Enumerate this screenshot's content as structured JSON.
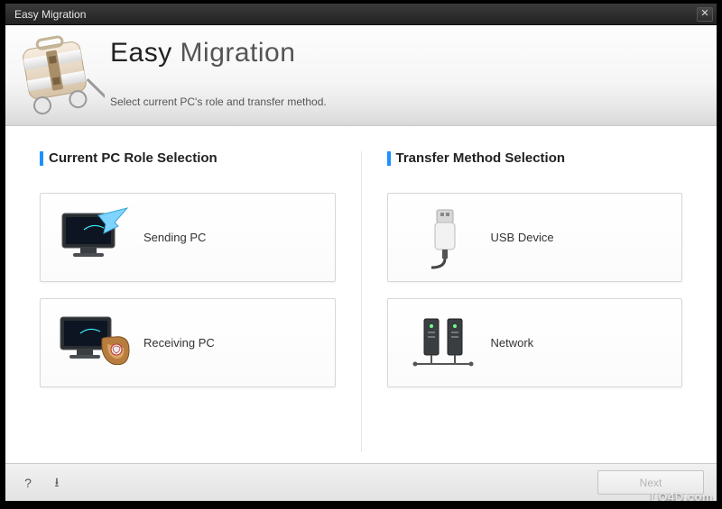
{
  "window": {
    "title": "Easy Migration"
  },
  "header": {
    "app_name_bold": "Easy",
    "app_name_light": " Migration",
    "subtitle": "Select current PC's role and transfer method."
  },
  "sections": {
    "role": {
      "title": "Current PC Role Selection",
      "options": [
        {
          "label": "Sending PC",
          "icon": "sending-pc-icon"
        },
        {
          "label": "Receiving PC",
          "icon": "receiving-pc-icon"
        }
      ]
    },
    "transfer": {
      "title": "Transfer Method Selection",
      "options": [
        {
          "label": "USB Device",
          "icon": "usb-device-icon"
        },
        {
          "label": "Network",
          "icon": "network-icon"
        }
      ]
    }
  },
  "footer": {
    "help_label": "?",
    "download_label": "⭳",
    "next_label": "Next"
  },
  "watermark": "LO4D.com"
}
